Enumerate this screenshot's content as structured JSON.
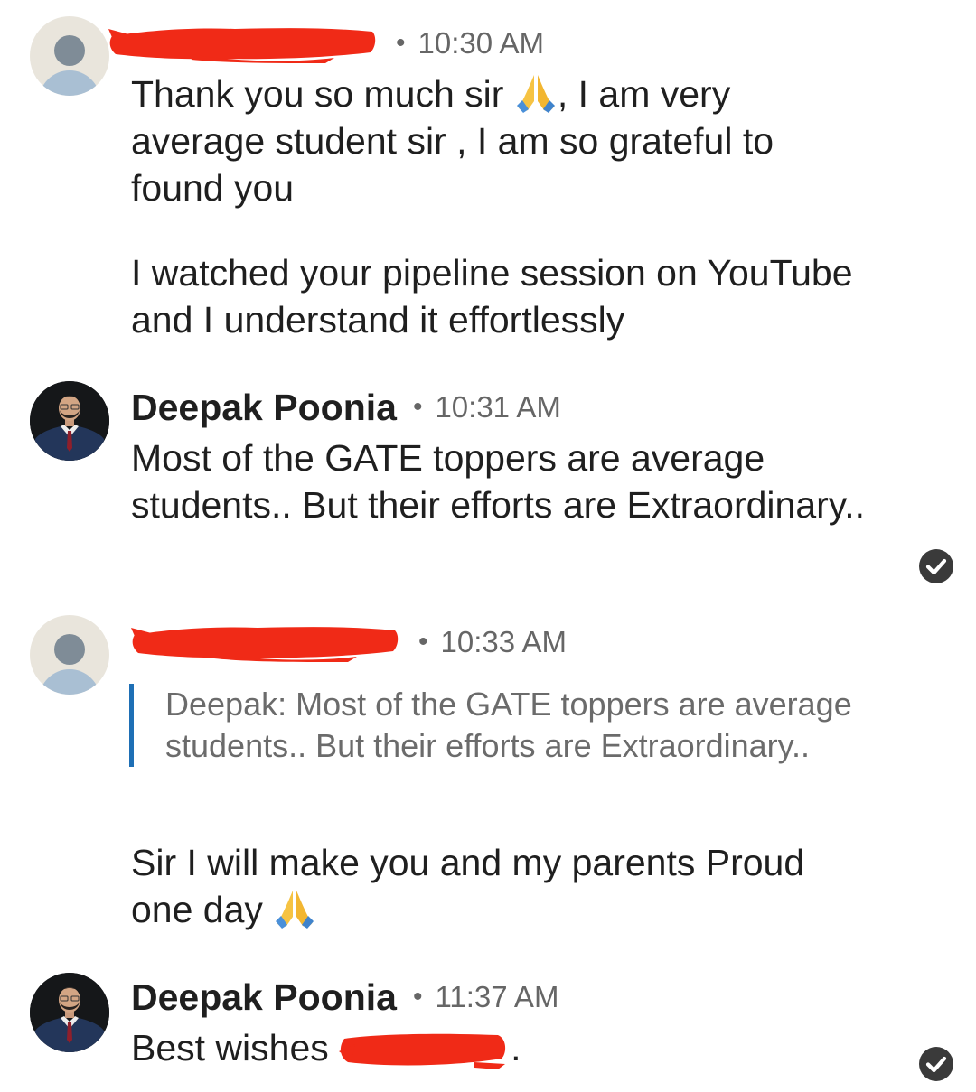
{
  "colors": {
    "text": "#1f1f1f",
    "muted": "#666666",
    "quote_bar": "#1e6fb5",
    "redaction": "#f02a17"
  },
  "messages": [
    {
      "sender": "",
      "sender_redacted": true,
      "avatar": "person-placeholder-icon",
      "time": "10:30 AM",
      "paragraphs": [
        {
          "before": "Thank you so much sir ",
          "emoji": "folded-hands-emoji",
          "after": ", I am very average student sir , I am so grateful to found you"
        },
        {
          "text": "I watched your pipeline session on YouTube and I understand it effortlessly"
        }
      ]
    },
    {
      "sender": "Deepak Poonia",
      "avatar": "profile-photo",
      "time": "10:31 AM",
      "text": "Most of the GATE toppers are average students.. But their efforts are Extraordinary..",
      "read_icon": "check-circle-icon"
    },
    {
      "sender": "",
      "sender_redacted": true,
      "avatar": "person-placeholder-icon",
      "time": "10:33 AM",
      "quote": "Deepak: Most of the GATE toppers are average students.. But their efforts are Extraordinary..",
      "before": "Sir I will make you and my parents Proud one day ",
      "emoji": "folded-hands-emoji"
    },
    {
      "sender": "Deepak Poonia",
      "avatar": "profile-photo",
      "time": "11:37 AM",
      "before": "Best wishes ",
      "after": ".",
      "read_icon": "check-circle-icon"
    }
  ]
}
